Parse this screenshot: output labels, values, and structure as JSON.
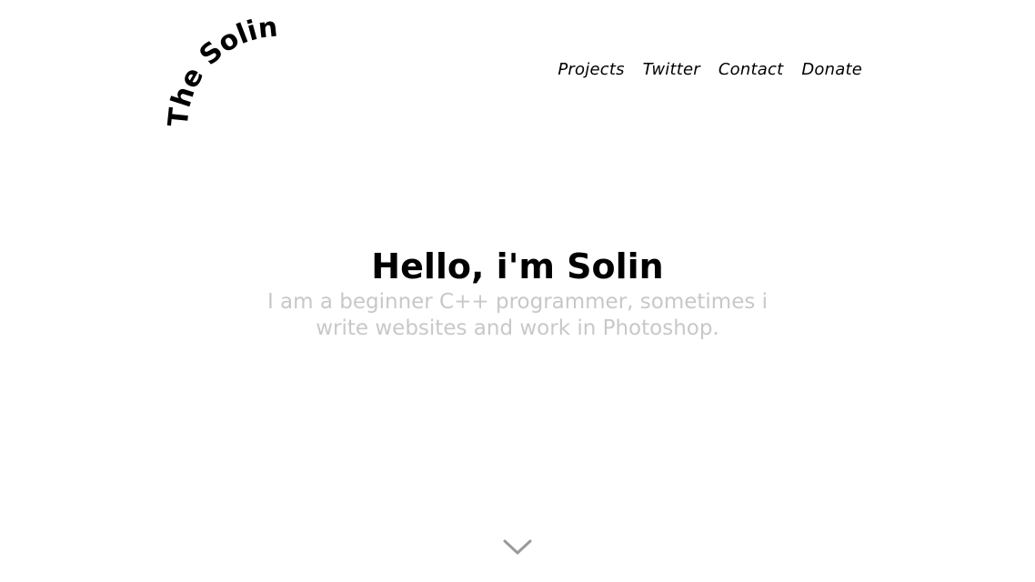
{
  "logo": {
    "text": "The Solin."
  },
  "nav": {
    "items": [
      {
        "label": "Projects"
      },
      {
        "label": "Twitter"
      },
      {
        "label": "Contact"
      },
      {
        "label": "Donate"
      }
    ]
  },
  "hero": {
    "title": "Hello, i'm Solin",
    "subtitle": "I am a beginner C++ programmer, sometimes i write websites and work in Photoshop."
  },
  "scroll": {
    "icon": "chevron-down-icon",
    "color": "#9a9a9a"
  }
}
